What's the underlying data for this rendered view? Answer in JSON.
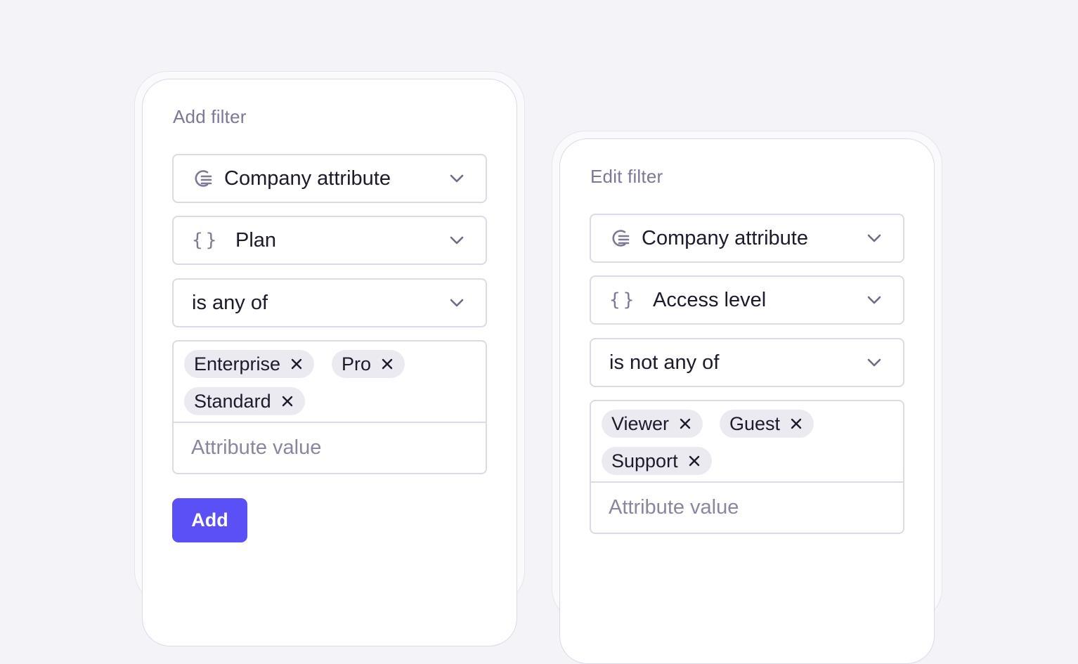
{
  "add_filter": {
    "title": "Add filter",
    "source": "Company attribute",
    "attribute": "Plan",
    "operator": "is any of",
    "tags": [
      "Enterprise",
      "Pro",
      "Standard"
    ],
    "value_placeholder": "Attribute value",
    "add_label": "Add"
  },
  "edit_filter": {
    "title": "Edit filter",
    "source": "Company attribute",
    "attribute": "Access level",
    "operator": "is not any of",
    "tags": [
      "Viewer",
      "Guest",
      "Support"
    ],
    "value_placeholder": "Attribute value"
  },
  "icons": {
    "source_icon": "company-attribute-icon",
    "attribute_icon": "braces-icon",
    "dropdown_icon": "chevron-down-icon",
    "remove_icon": "close-icon"
  },
  "colors": {
    "accent": "#5b4ff6",
    "background": "#f4f3f8",
    "muted_text": "#7c7896",
    "tag_background": "#eceaf1"
  }
}
